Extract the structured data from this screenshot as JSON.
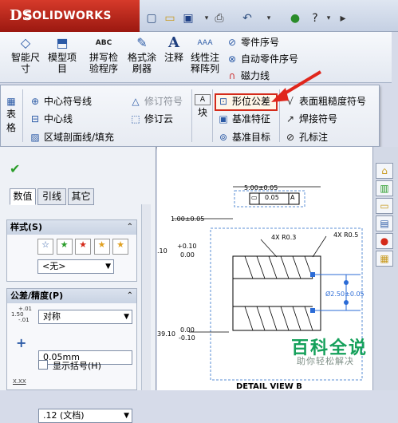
{
  "app": {
    "logo_text": "SOLIDWORKS",
    "logo_mark": "DS"
  },
  "quick_access": {
    "icons": [
      "new-file-icon",
      "open-folder-icon",
      "save-icon",
      "print-icon",
      "undo-icon",
      "traffic-light-icon",
      "help-icon"
    ],
    "arrow": "▸"
  },
  "command_manager": {
    "smart_dimension": "智能尺\n寸",
    "model_items": "模型项\n目",
    "spell_check": "拼写检\n验程序",
    "format_painter": "格式涂\n刷器",
    "note": "注释",
    "linear_note_pattern": "线性注\n释阵列",
    "balloon": "零件序号",
    "auto_balloon": "自动零件序号",
    "magnetic_line": "磁力线",
    "spell_abc": "ABC"
  },
  "expanded_row": {
    "table": "表格",
    "center_mark": "中心符号线",
    "centerline": "中心线",
    "area_hatch": "区域剖面线/填充",
    "revision_symbol": "修订符号",
    "revision_cloud": "修订云",
    "block": "块",
    "geometric_tolerance": "形位公差",
    "datum_feature": "基准特征",
    "datum_target": "基准目标",
    "surface_finish": "表面粗糙度符号",
    "weld_symbol": "焊接符号",
    "hole_callout": "孔标注"
  },
  "panel": {
    "tabs": [
      "数值",
      "引线",
      "其它"
    ],
    "style_group": {
      "title": "样式(S)",
      "select_value": "<无>"
    },
    "tolerance_group": {
      "title": "公差/精度(P)",
      "type_value": "对称",
      "tolerance_value": "0.05mm",
      "show_parentheses": "显示括号(H)",
      "precision_value": ".12 (文档)",
      "icon_label_1": "1.50",
      "icon_sup": "+.01",
      "icon_sub": "-.01",
      "precision_icon": "X.XX"
    }
  },
  "drawing": {
    "dim_top": "5.00±0.05",
    "gtol_value": "0.05",
    "gtol_datum": "A",
    "dim_left1": "1.00±0.05",
    "dim_left2_plus": "+0.10",
    "dim_left2_zero": "0.00",
    "dim_left2_base": ".10",
    "radius1": "4X R0.3",
    "radius2": "4X R0.5",
    "diameter": "Ø2.50±0.05",
    "dim_bottom_base": "39.10",
    "dim_bottom_zero": "0.00",
    "dim_bottom_minus": "-0.10",
    "detail_label": "DETAIL VIEW B"
  },
  "watermark": {
    "title": "百科全说",
    "subtitle": "助你轻松解决"
  },
  "colors": {
    "highlight_border": "#d42a1a",
    "arrow": "#e0261c",
    "watermark": "#14a05a"
  }
}
